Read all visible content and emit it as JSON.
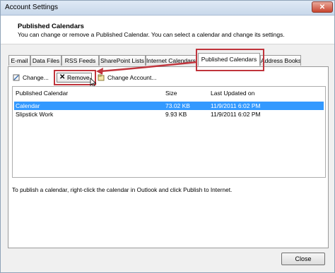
{
  "window": {
    "title": "Account Settings",
    "close_glyph": "✕"
  },
  "header": {
    "title": "Published Calendars",
    "description": "You can change or remove a Published Calendar. You can select a calendar and change its settings."
  },
  "tabs": [
    {
      "label": "E-mail"
    },
    {
      "label": "Data Files"
    },
    {
      "label": "RSS Feeds"
    },
    {
      "label": "SharePoint Lists"
    },
    {
      "label": "Internet Calendars"
    },
    {
      "label": "Published Calendars",
      "active": true
    },
    {
      "label": "Address Books"
    }
  ],
  "toolbar": {
    "change_label": "Change...",
    "remove_label": "Remove",
    "change_account_label": "Change Account..."
  },
  "list": {
    "columns": {
      "name": "Published Calendar",
      "size": "Size",
      "updated": "Last Updated on"
    },
    "rows": [
      {
        "name": "Calendar",
        "size": "73.02 KB",
        "updated": "11/9/2011 6:02 PM",
        "selected": true
      },
      {
        "name": "Slipstick Work",
        "size": "9.93 KB",
        "updated": "11/9/2011 6:02 PM",
        "selected": false
      }
    ]
  },
  "hint": "To publish a calendar, right-click the calendar in Outlook and click Publish to Internet.",
  "footer": {
    "close_label": "Close"
  },
  "colors": {
    "selection": "#3399ff",
    "annotation": "#c0343c"
  },
  "icons": [
    "close-icon",
    "change-icon",
    "remove-icon",
    "change-account-icon",
    "mouse-cursor-icon"
  ]
}
